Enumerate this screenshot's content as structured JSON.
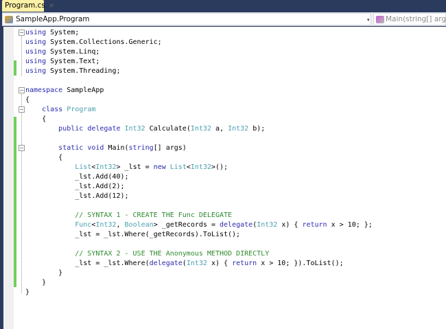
{
  "tab": {
    "label": "Program.cs",
    "close": "×"
  },
  "nav": {
    "class_selector": "SampleApp.Program",
    "member_selector": "Main(string[] args)",
    "dropdown": "▾"
  },
  "colors": {
    "keyword": "#2a2ab0",
    "type": "#4aa0b0",
    "comment": "#2e8b2e",
    "change_bar": "#6fcf5c",
    "tab": "#fdf1a6"
  },
  "code": [
    [
      [
        "kw",
        "using"
      ],
      [
        "t",
        " System;"
      ]
    ],
    [
      [
        "kw",
        "using"
      ],
      [
        "t",
        " System.Collections.Generic;"
      ]
    ],
    [
      [
        "kw",
        "using"
      ],
      [
        "t",
        " System.Linq;"
      ]
    ],
    [
      [
        "kw",
        "using"
      ],
      [
        "t",
        " System.Text;"
      ]
    ],
    [
      [
        "kw",
        "using"
      ],
      [
        "t",
        " System.Threading;"
      ]
    ],
    [],
    [
      [
        "kw",
        "namespace"
      ],
      [
        "t",
        " SampleApp"
      ]
    ],
    [
      [
        "t",
        "{"
      ]
    ],
    [
      [
        "t",
        "    "
      ],
      [
        "kw",
        "class"
      ],
      [
        "t",
        " "
      ],
      [
        "ty",
        "Program"
      ]
    ],
    [
      [
        "t",
        "    {"
      ]
    ],
    [
      [
        "t",
        "        "
      ],
      [
        "kw",
        "public delegate"
      ],
      [
        "t",
        " "
      ],
      [
        "ty",
        "Int32"
      ],
      [
        "t",
        " Calculate("
      ],
      [
        "ty",
        "Int32"
      ],
      [
        "t",
        " a, "
      ],
      [
        "ty",
        "Int32"
      ],
      [
        "t",
        " b);"
      ]
    ],
    [],
    [
      [
        "t",
        "        "
      ],
      [
        "kw",
        "static void"
      ],
      [
        "t",
        " Main("
      ],
      [
        "kw",
        "string"
      ],
      [
        "t",
        "[] args)"
      ]
    ],
    [
      [
        "t",
        "        {"
      ]
    ],
    [
      [
        "t",
        "            "
      ],
      [
        "ty",
        "List"
      ],
      [
        "t",
        "<"
      ],
      [
        "ty",
        "Int32"
      ],
      [
        "t",
        "> _lst = "
      ],
      [
        "kw",
        "new"
      ],
      [
        "t",
        " "
      ],
      [
        "ty",
        "List"
      ],
      [
        "t",
        "<"
      ],
      [
        "ty",
        "Int32"
      ],
      [
        "t",
        ">();"
      ]
    ],
    [
      [
        "t",
        "            _lst.Add(40);"
      ]
    ],
    [
      [
        "t",
        "            _lst.Add(2);"
      ]
    ],
    [
      [
        "t",
        "            _lst.Add(12);"
      ]
    ],
    [],
    [
      [
        "t",
        "            "
      ],
      [
        "cm",
        "// SYNTAX 1 - CREATE THE Func DELEGATE"
      ]
    ],
    [
      [
        "t",
        "            "
      ],
      [
        "ty",
        "Func"
      ],
      [
        "t",
        "<"
      ],
      [
        "ty",
        "Int32"
      ],
      [
        "t",
        ", "
      ],
      [
        "ty",
        "Boolean"
      ],
      [
        "t",
        "> _getRecords = "
      ],
      [
        "kw",
        "delegate"
      ],
      [
        "t",
        "("
      ],
      [
        "ty",
        "Int32"
      ],
      [
        "t",
        " x) { "
      ],
      [
        "kw",
        "return"
      ],
      [
        "t",
        " x > 10; };"
      ]
    ],
    [
      [
        "t",
        "            _lst = _lst.Where(_getRecords).ToList();"
      ]
    ],
    [],
    [
      [
        "t",
        "            "
      ],
      [
        "cm",
        "// SYNTAX 2 - USE THE Anonymous METHOD DIRECTLY"
      ]
    ],
    [
      [
        "t",
        "            _lst = _lst.Where("
      ],
      [
        "kw",
        "delegate"
      ],
      [
        "t",
        "("
      ],
      [
        "ty",
        "Int32"
      ],
      [
        "t",
        " x) { "
      ],
      [
        "kw",
        "return"
      ],
      [
        "t",
        " x > 10; }).ToList();"
      ]
    ],
    [
      [
        "t",
        "        }"
      ]
    ],
    [
      [
        "t",
        "    }"
      ]
    ],
    [
      [
        "t",
        "}"
      ]
    ]
  ]
}
